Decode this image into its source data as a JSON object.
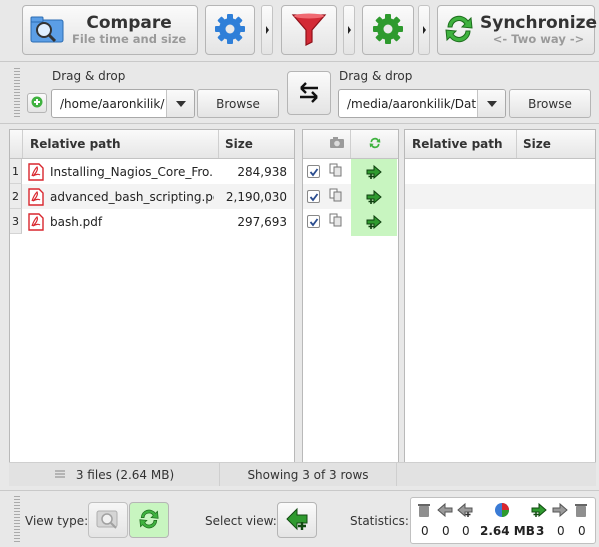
{
  "toolbar": {
    "compare_title": "Compare",
    "compare_sub": "File time and size",
    "sync_title": "Synchronize",
    "sync_sub": "<- Two way ->"
  },
  "left_folder": {
    "label": "Drag & drop",
    "path": "/home/aaronkilik/",
    "browse": "Browse"
  },
  "right_folder": {
    "label": "Drag & drop",
    "path": "/media/aaronkilik/Dat",
    "browse": "Browse"
  },
  "grid_left": {
    "col_path": "Relative path",
    "col_size": "Size",
    "rows": [
      {
        "num": "1",
        "name": "Installing_Nagios_Core_Fro...",
        "size": "284,938"
      },
      {
        "num": "2",
        "name": "advanced_bash_scripting.pdf",
        "size": "2,190,030"
      },
      {
        "num": "3",
        "name": "bash.pdf",
        "size": "297,693"
      }
    ]
  },
  "grid_right": {
    "col_path": "Relative path",
    "col_size": "Size"
  },
  "status": {
    "files": "3 files  (2.64 MB)",
    "showing": "Showing 3 of 3 rows"
  },
  "bottom": {
    "view_type": "View type:",
    "select_view": "Select view:",
    "statistics": "Statistics:",
    "stats": [
      "0",
      "0",
      "0",
      "2.64 MB",
      "3",
      "0",
      "0"
    ]
  },
  "colors": {
    "action_green": "#c8f5c0",
    "pdf_red": "#d9272e",
    "accent_blue": "#3a7bd5"
  }
}
